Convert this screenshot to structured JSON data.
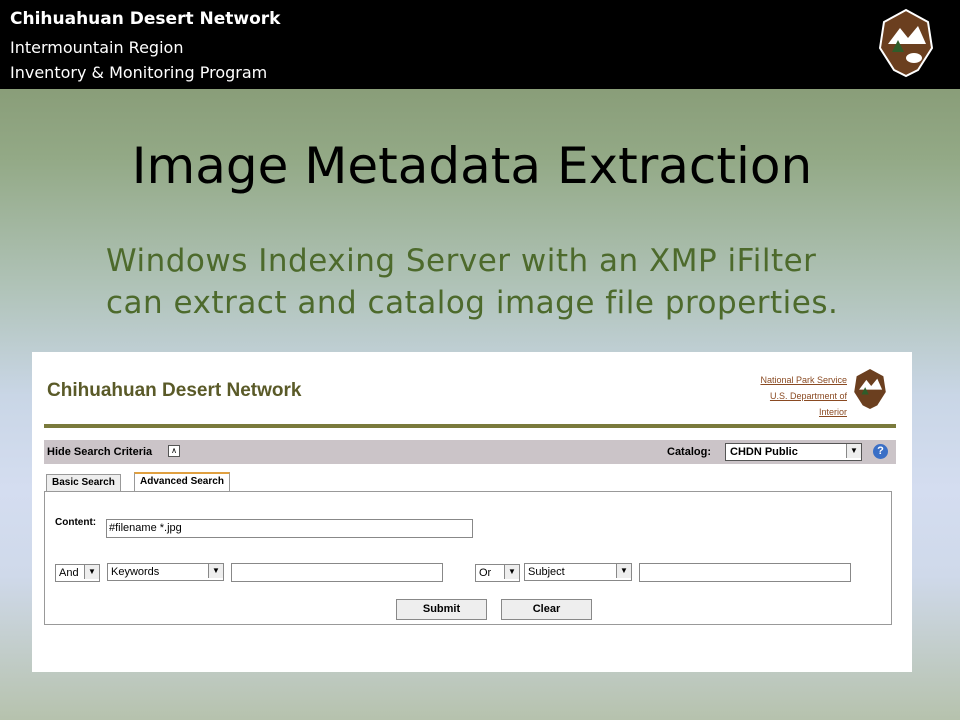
{
  "header": {
    "org": "Chihuahuan Desert Network",
    "region": "Intermountain Region",
    "program": "Inventory & Monitoring Program"
  },
  "slide": {
    "title": "Image Metadata Extraction",
    "subtitle": "Windows Indexing Server with an XMP iFilter can extract and catalog image file properties."
  },
  "screenshot": {
    "site_title": "Chihuahuan Desert Network",
    "links": [
      "National Park Service",
      "U.S. Department of",
      "Interior"
    ],
    "criteria_bar": {
      "hide_label": "Hide Search Criteria",
      "catalog_label": "Catalog:",
      "catalog_value": "CHDN Public"
    },
    "tabs": [
      {
        "label": "Basic Search"
      },
      {
        "label": "Advanced Search"
      }
    ],
    "form": {
      "content_label": "Content:",
      "content_value": "#filename *.jpg",
      "op1": "And",
      "field1": "Keywords",
      "value1": "",
      "op2": "Or",
      "field2": "Subject",
      "value2": "",
      "submit_label": "Submit",
      "clear_label": "Clear"
    }
  },
  "colors": {
    "subtitle": "#4d6a2c",
    "site_title": "#5a5a28",
    "links": "#8a4a22"
  }
}
